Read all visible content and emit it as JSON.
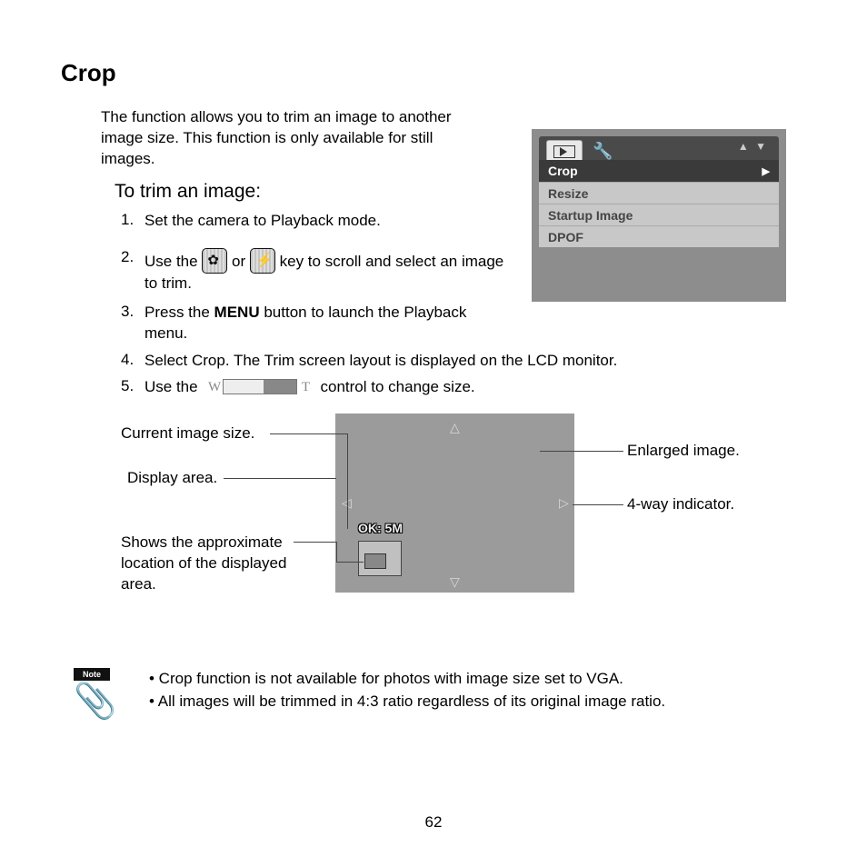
{
  "title": "Crop",
  "intro": "The function allows you to trim an image to another image size. This function is only available for still images.",
  "subtitle": "To trim an image:",
  "steps": {
    "s1": {
      "num": "1.",
      "text": "Set the camera to Playback mode."
    },
    "s2": {
      "num": "2.",
      "pre": "Use the ",
      "mid": " or ",
      "post": " key to scroll and select an image to trim."
    },
    "s3": {
      "num": "3.",
      "pre": "Press the ",
      "bold": "MENU",
      "post": " button to launch the Playback menu."
    },
    "s4": {
      "num": "4.",
      "text": "Select Crop. The Trim screen layout is displayed on the LCD monitor."
    },
    "s5": {
      "num": "5.",
      "pre": "Use the ",
      "post": " control to change size."
    }
  },
  "menu": {
    "arrows": "▲ ▼",
    "items": [
      "Crop",
      "Resize",
      "Startup Image",
      "DPOF"
    ],
    "selected_arrow": "▶"
  },
  "diagram": {
    "ok_label": "OK: 5M",
    "callouts": {
      "current_size": "Current image size.",
      "display_area": "Display area.",
      "approx_loc": "Shows the approximate location of the displayed area.",
      "enlarged": "Enlarged image.",
      "fourway": "4-way indicator."
    }
  },
  "note": {
    "label": "Note",
    "bullets": [
      "• Crop function is not available for photos with image size set to VGA.",
      "• All images will be trimmed in 4:3 ratio regardless of its original image ratio."
    ]
  },
  "page_number": "62"
}
